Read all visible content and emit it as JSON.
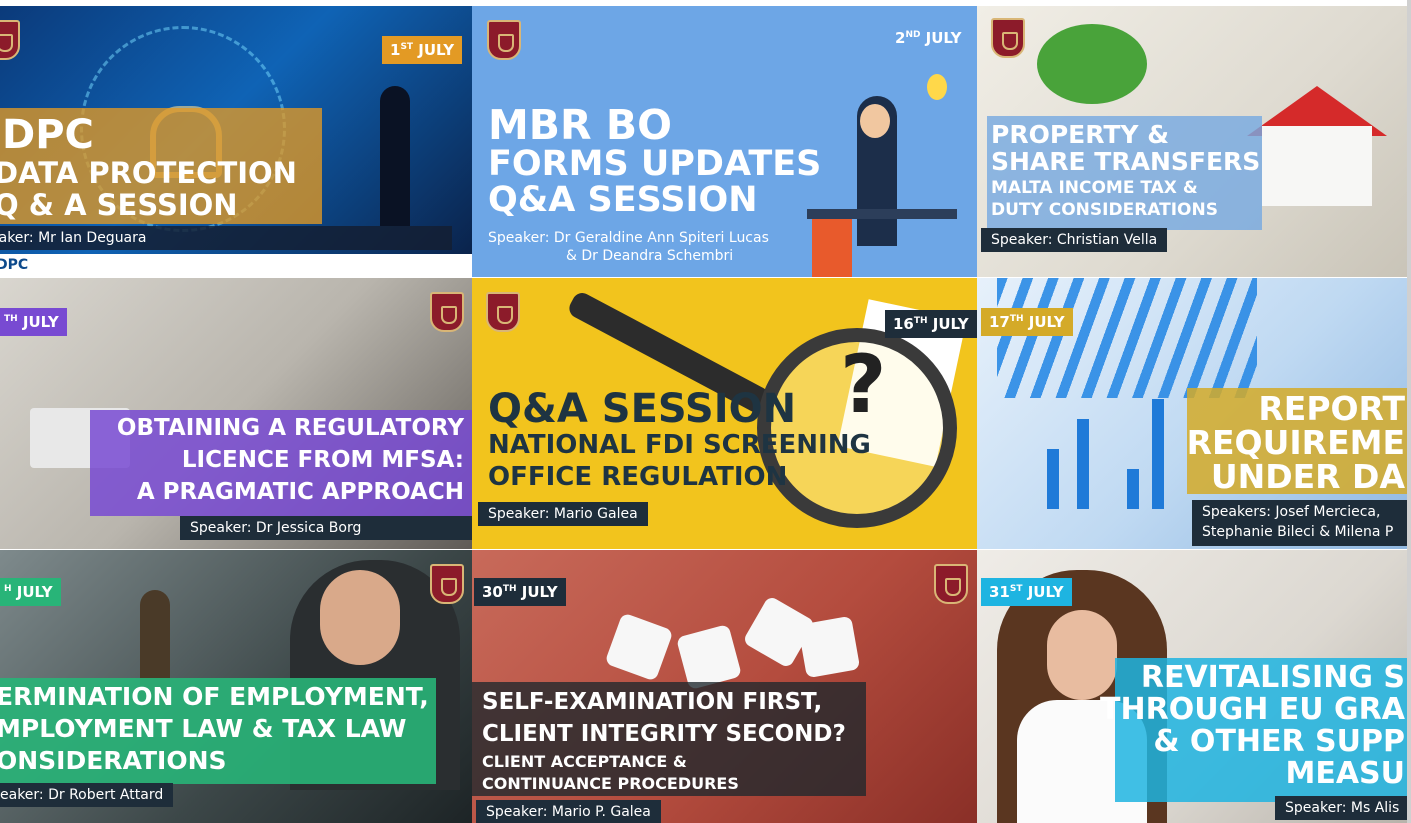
{
  "tiles": [
    {
      "date_main": "1",
      "date_sup": "ST",
      "date_tail": " JULY",
      "lines": [
        "DPC",
        "DATA PROTECTION",
        "Q & A SESSION"
      ],
      "speaker": "Speaker:  Mr Ian Deguara",
      "logo_text": "DPC"
    },
    {
      "date_main": "2",
      "date_sup": "ND",
      "date_tail": " JULY",
      "lines": [
        "MBR BO",
        "FORMS UPDATES",
        "Q&A SESSION"
      ],
      "speaker_lines": [
        "Speaker:  Dr Geraldine Ann Spiteri Lucas",
        "& Dr Deandra Schembri"
      ]
    },
    {
      "lines": [
        "PROPERTY &",
        "SHARE TRANSFERS",
        "MALTA INCOME TAX &",
        "DUTY CONSIDERATIONS"
      ],
      "speaker": "Speaker: Christian Vella"
    },
    {
      "date_main": "",
      "date_sup": "TH",
      "date_tail": " JULY",
      "lines": [
        "OBTAINING A REGULATORY",
        "LICENCE FROM MFSA:",
        "A PRAGMATIC APPROACH"
      ],
      "speaker": "Speaker:  Dr Jessica Borg"
    },
    {
      "date_main": "16",
      "date_sup": "TH",
      "date_tail": " JULY",
      "lines": [
        "Q&A SESSION",
        "NATIONAL FDI SCREENING",
        "OFFICE REGULATION"
      ],
      "speaker": "Speaker:  Mario Galea"
    },
    {
      "date_main": "17",
      "date_sup": "TH",
      "date_tail": " JULY",
      "lines": [
        "REPORT",
        "REQUIREME",
        "UNDER DA"
      ],
      "speaker_lines": [
        "Speakers:  Josef Mercieca,",
        "Stephanie Bileci & Milena P"
      ]
    },
    {
      "date_main": "",
      "date_sup": "H",
      "date_tail": " JULY",
      "lines": [
        "ERMINATION OF EMPLOYMENT,",
        "MPLOYMENT LAW & TAX LAW",
        "ONSIDERATIONS"
      ],
      "speaker": "eaker:  Dr Robert Attard"
    },
    {
      "date_main": "30",
      "date_sup": "TH",
      "date_tail": " JULY",
      "lines": [
        "SELF-EXAMINATION FIRST,",
        "CLIENT INTEGRITY SECOND?",
        "CLIENT ACCEPTANCE &",
        "CONTINUANCE PROCEDURES"
      ],
      "speaker": "Speaker:  Mario P. Galea"
    },
    {
      "date_main": "31",
      "date_sup": "ST",
      "date_tail": " JULY",
      "lines": [
        "REVITALISING S",
        "THROUGH EU GRA",
        "& OTHER SUPP",
        "MEASU"
      ],
      "speaker": "Speaker: Ms Alis"
    }
  ],
  "first_line_t1": "eaker:  Mr Ian Deguara",
  "colors": {
    "orange": "#e39a24",
    "purple": "#784ad2",
    "green": "#28b478",
    "cyan": "#1eb4e1",
    "gold": "#d4aa28",
    "navy_date": "#1e2d3a",
    "maroon_crest": "#8c1b2a"
  }
}
